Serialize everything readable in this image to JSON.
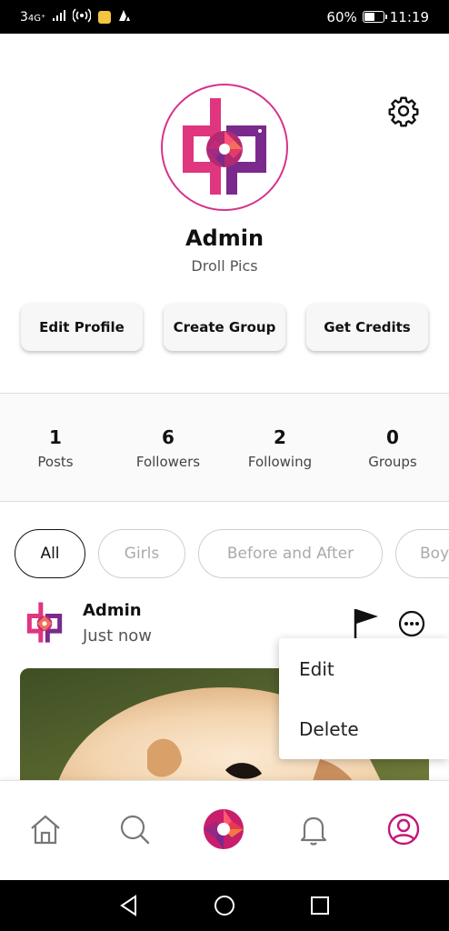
{
  "status_bar": {
    "network": "3",
    "network_sup": "4G⁺",
    "battery": "60%",
    "battery_level": 0.6,
    "time": "11:19"
  },
  "profile": {
    "name": "Admin",
    "subtitle": "Droll Pics",
    "settings_icon": "gear-icon"
  },
  "actions": {
    "edit_profile": "Edit Profile",
    "create_group": "Create Group",
    "get_credits": "Get Credits"
  },
  "stats": [
    {
      "value": "1",
      "label": "Posts"
    },
    {
      "value": "6",
      "label": "Followers"
    },
    {
      "value": "2",
      "label": "Following"
    },
    {
      "value": "0",
      "label": "Groups"
    }
  ],
  "filters": {
    "selected": "All",
    "items": [
      "All",
      "Girls",
      "Before and After",
      "Boy"
    ]
  },
  "post": {
    "author": "Admin",
    "time": "Just now"
  },
  "post_menu": {
    "items": [
      "Edit",
      "Delete"
    ]
  },
  "bottom_nav": {
    "items": [
      "home-icon",
      "search-icon",
      "camera-aperture-icon",
      "bell-icon",
      "profile-icon"
    ],
    "active_color": "#c2187a"
  },
  "brand": {
    "pink": "#e0357f",
    "purple": "#7a2a8c",
    "accent": "#c2187a"
  }
}
